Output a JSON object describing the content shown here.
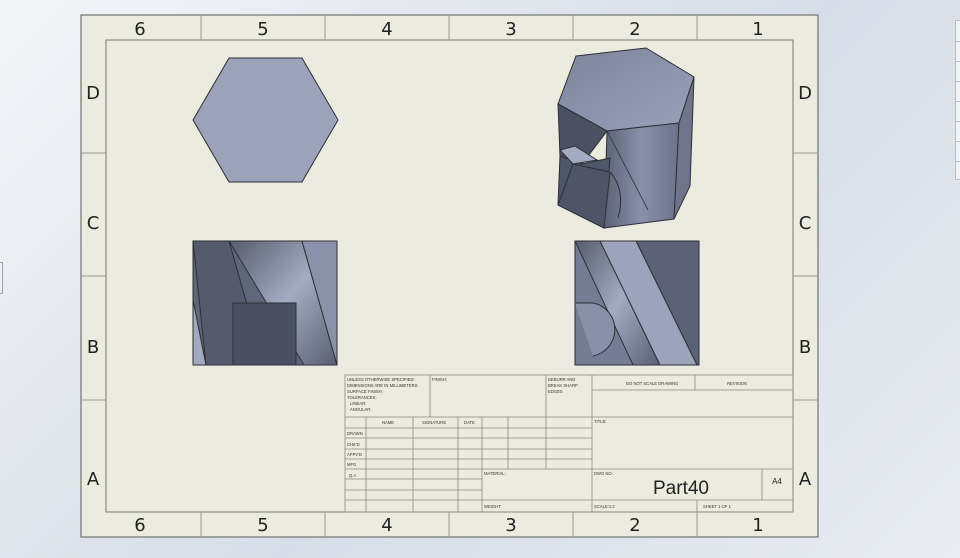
{
  "sheet": {
    "column_labels": [
      "6",
      "5",
      "4",
      "3",
      "2",
      "1"
    ],
    "row_labels": [
      "D",
      "C",
      "B",
      "A"
    ],
    "colors": {
      "sheet_bg": "#ebebdf",
      "border": "#5a5a5a",
      "face_light": "#9fa6bd",
      "face_mid": "#7b8198",
      "face_dark": "#555a6b"
    }
  },
  "title_block": {
    "unless_note": [
      "UNLESS OTHERWISE SPECIFIED:",
      "DIMENSIONS ARE IN MILLIMETERS",
      "SURFACE FINISH:",
      "TOLERANCES:",
      "LINEAR:",
      "ANGULAR:"
    ],
    "finish_label": "FINISH:",
    "deburr_note": [
      "DEBURR AND",
      "BREAK SHARP",
      "EDGES"
    ],
    "do_not_scale": "DO NOT SCALE DRAWING",
    "revision": "REVISION",
    "title_label": "TITLE:",
    "column_headers": [
      "NAME",
      "SIGNATURE",
      "DATE"
    ],
    "row_labels": [
      "DRAWN",
      "CHK'D",
      "APPV'D",
      "MFG",
      "Q.A"
    ],
    "material_label": "MATERIAL:",
    "dwg_no_label": "DWG NO.",
    "part_name": "Part40",
    "sheet_size": "A4",
    "weight_label": "WEIGHT:",
    "scale_label": "SCALE:1:2",
    "sheet_label": "SHEET 1 OF 1"
  },
  "views": [
    "front-view-hexagon",
    "isometric-view",
    "bottom-view",
    "right-view"
  ]
}
